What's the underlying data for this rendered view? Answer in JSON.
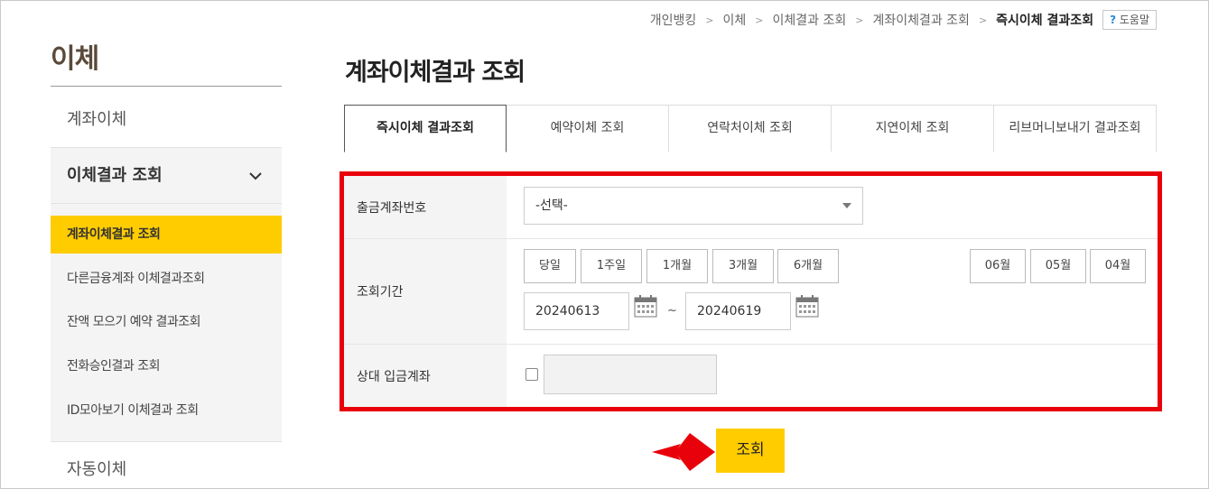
{
  "sidebar": {
    "title": "이체",
    "item_transfer": "계좌이체",
    "group_title": "이체결과 조회",
    "sub_items": [
      "계좌이체결과 조회",
      "다른금융계좌 이체결과조회",
      "잔액 모으기 예약 결과조회",
      "전화승인결과 조회",
      "ID모아보기 이체결과 조회"
    ],
    "item_auto": "자동이체"
  },
  "breadcrumb": {
    "items": [
      "개인뱅킹",
      "이체",
      "이체결과 조회",
      "계좌이체결과 조회",
      "즉시이체 결과조회"
    ],
    "help_label": "도움말"
  },
  "page_title": "계좌이체결과 조회",
  "tabs": [
    "즉시이체 결과조회",
    "예약이체 조회",
    "연락처이체 조회",
    "지연이체 조회",
    "리브머니보내기 결과조회"
  ],
  "form": {
    "account_label": "출금계좌번호",
    "account_select": "-선택-",
    "period_label": "조회기간",
    "period_buttons": [
      "당일",
      "1주일",
      "1개월",
      "3개월",
      "6개월"
    ],
    "month_buttons": [
      "06월",
      "05월",
      "04월"
    ],
    "start_date": "20240613",
    "tilde": "~",
    "end_date": "20240619",
    "counterpart_label": "상대 입금계좌"
  },
  "search_button": "조회",
  "colors": {
    "accent": "#ffcc00",
    "highlight_border": "#e8000b"
  }
}
